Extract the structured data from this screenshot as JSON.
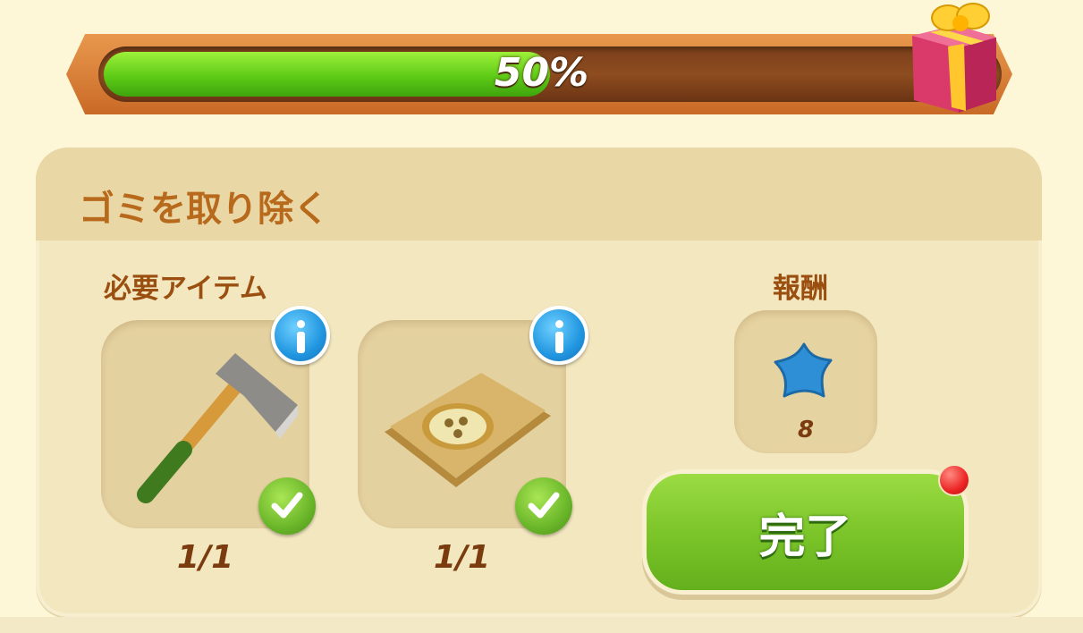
{
  "progress": {
    "value": 0.5,
    "label": "50%"
  },
  "quest": {
    "title": "ゴミを取り除く",
    "required_label": "必要アイテム",
    "reward_label": "報酬",
    "items": [
      {
        "name": "axe",
        "count": "1/1",
        "complete": true
      },
      {
        "name": "cloth-bundle",
        "count": "1/1",
        "complete": true
      }
    ],
    "reward": {
      "icon": "blue-star-icon",
      "count": "8"
    },
    "complete_button": "完了"
  },
  "colors": {
    "accent_green": "#7cc52a",
    "title_brown": "#b86a1c",
    "bar_orange": "#d9823a"
  }
}
